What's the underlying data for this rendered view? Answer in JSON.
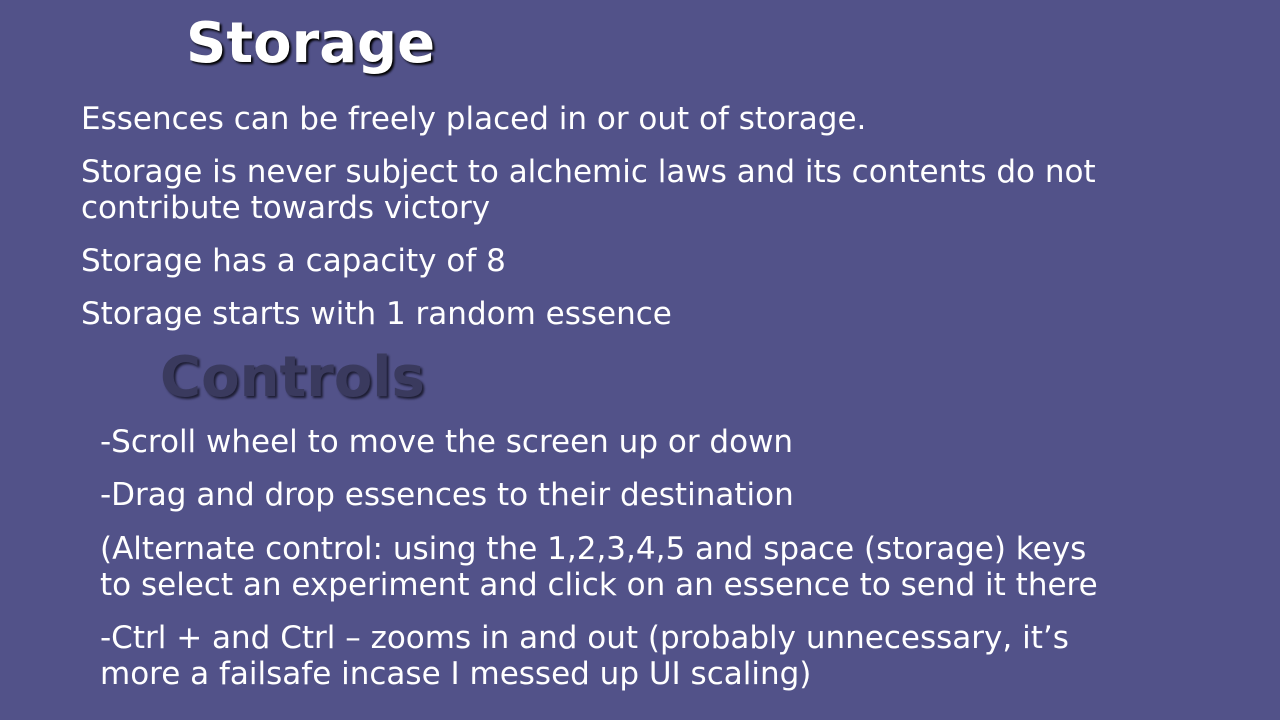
{
  "storage": {
    "title": "Storage",
    "points": [
      "Essences can be freely placed in or out of storage.",
      [
        "Storage is never subject to alchemic laws and its contents do not",
        "contribute towards victory"
      ],
      "Storage has a capacity of 8",
      "Storage starts with 1 random essence"
    ]
  },
  "controls": {
    "title": "Controls",
    "points": [
      "-Scroll wheel to move the screen up or down",
      "-Drag and drop essences to their destination",
      [
        "(Alternate control:  using the 1,2,3,4,5 and space (storage) keys",
        "to select an experiment and click on an essence to send it there"
      ],
      [
        "-Ctrl + and Ctrl – zooms in and out (probably unnecessary, it’s",
        "more a failsafe incase I messed up UI scaling)"
      ]
    ]
  }
}
